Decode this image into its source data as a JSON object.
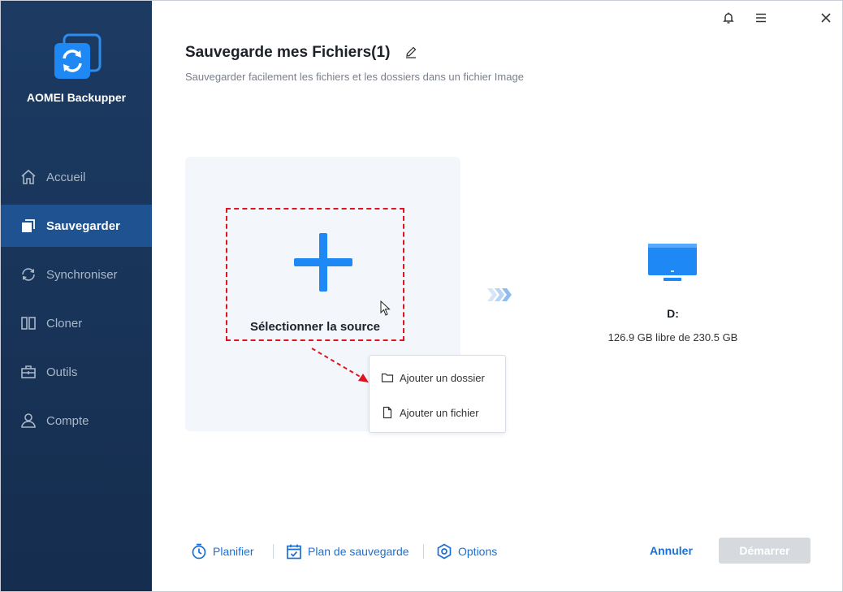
{
  "app": {
    "name": "AOMEI Backupper"
  },
  "sidebar": {
    "items": [
      {
        "label": "Accueil",
        "icon": "home-icon",
        "active": false
      },
      {
        "label": "Sauvegarder",
        "icon": "backup-icon",
        "active": true
      },
      {
        "label": "Synchroniser",
        "icon": "sync-icon",
        "active": false
      },
      {
        "label": "Cloner",
        "icon": "clone-icon",
        "active": false
      },
      {
        "label": "Outils",
        "icon": "tools-icon",
        "active": false
      },
      {
        "label": "Compte",
        "icon": "account-icon",
        "active": false
      }
    ]
  },
  "titlebar": {
    "icons": [
      "bell-icon",
      "menu-icon",
      "close-icon"
    ]
  },
  "header": {
    "title": "Sauvegarde mes Fichiers(1)",
    "subtitle": "Sauvegarder facilement les fichiers et les dossiers dans un fichier Image"
  },
  "source": {
    "label": "Sélectionner la source",
    "menu": [
      {
        "label": "Ajouter un dossier",
        "icon": "folder-icon"
      },
      {
        "label": "Ajouter un fichier",
        "icon": "file-icon"
      }
    ]
  },
  "destination": {
    "drive": "D:",
    "space": "126.9 GB libre de 230.5 GB"
  },
  "bottom": {
    "schedule": "Planifier",
    "plan": "Plan de sauvegarde",
    "options": "Options",
    "cancel": "Annuler",
    "start": "Démarrer"
  },
  "colors": {
    "sidebar": "#1c3b63",
    "active": "#1f5291",
    "accent": "#1a70d6",
    "highlight": "#e0141e"
  }
}
